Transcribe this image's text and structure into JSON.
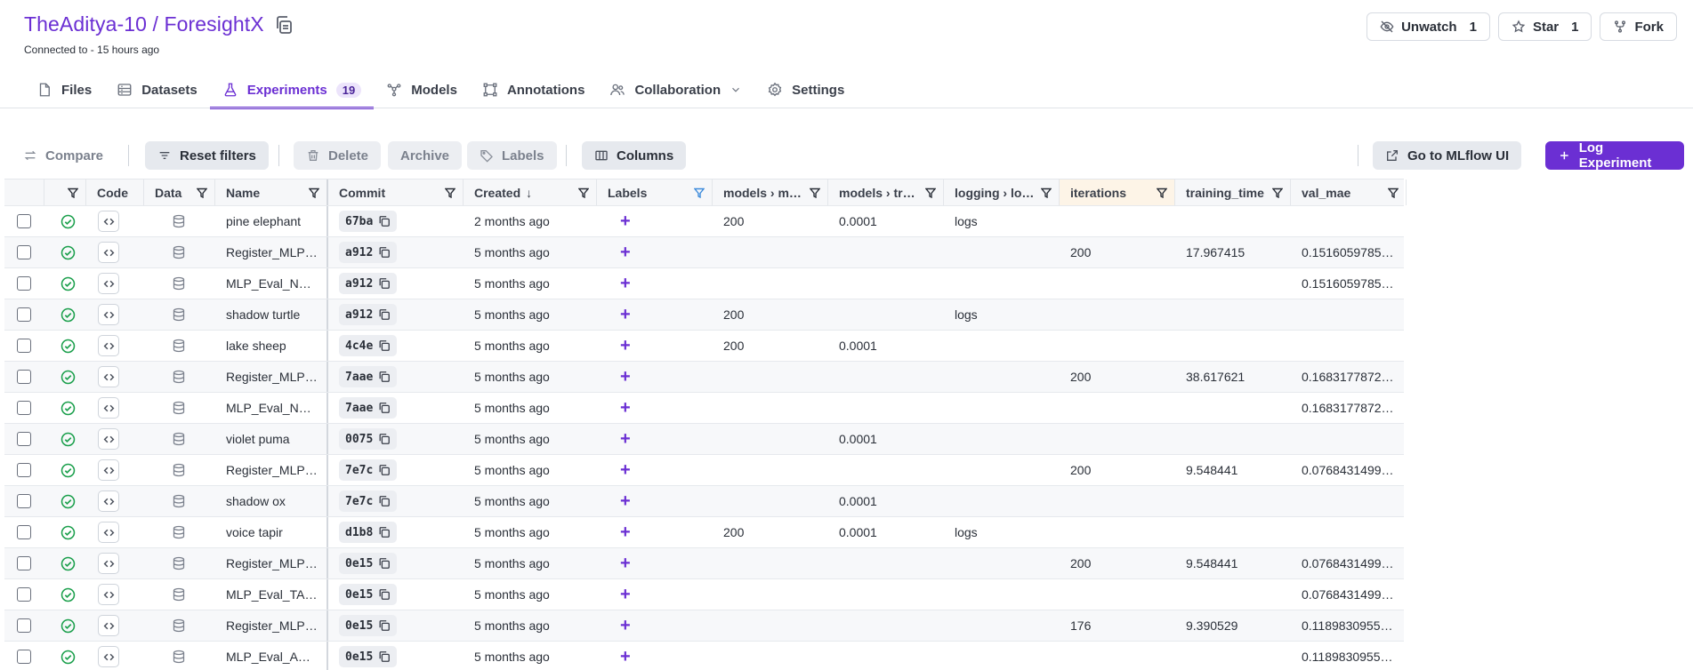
{
  "repo": {
    "title": "TheAditya-10 / ForesightX",
    "connected": "Connected to  - 15 hours ago"
  },
  "top_actions": {
    "unwatch_label": "Unwatch",
    "unwatch_count": "1",
    "star_label": "Star",
    "star_count": "1",
    "fork_label": "Fork"
  },
  "tabs": [
    {
      "label": "Files",
      "icon": "file-icon"
    },
    {
      "label": "Datasets",
      "icon": "datasets-icon"
    },
    {
      "label": "Experiments",
      "icon": "flask-icon",
      "count": "19",
      "active": true
    },
    {
      "label": "Models",
      "icon": "models-icon"
    },
    {
      "label": "Annotations",
      "icon": "annotations-icon"
    },
    {
      "label": "Collaboration",
      "icon": "people-icon",
      "dropdown": true
    },
    {
      "label": "Settings",
      "icon": "gear-icon"
    }
  ],
  "toolbar": {
    "compare": "Compare",
    "reset_filters": "Reset filters",
    "delete": "Delete",
    "archive": "Archive",
    "labels": "Labels",
    "columns": "Columns",
    "mlflow": "Go to MLflow UI",
    "log_experiment": "Log Experiment"
  },
  "columns": {
    "code": "Code",
    "data": "Data",
    "name": "Name",
    "commit": "Commit",
    "created": "Created",
    "labels": "Labels",
    "models_m": "models › m…",
    "models_tr": "models › tr…",
    "logging": "logging › lo…",
    "iterations": "iterations",
    "training_time": "training_time",
    "val_mae": "val_mae"
  },
  "rows": [
    {
      "name": "pine elephant",
      "commit": "67ba",
      "created": "2 months ago",
      "mm": "200",
      "mt": "0.0001",
      "log": "logs",
      "it": "",
      "tt": "",
      "vm": ""
    },
    {
      "name": "Register_MLP…",
      "commit": "a912",
      "created": "5 months ago",
      "mm": "",
      "mt": "",
      "log": "",
      "it": "200",
      "tt": "17.967415",
      "vm": "0.1516059785…"
    },
    {
      "name": "MLP_Eval_N…",
      "commit": "a912",
      "created": "5 months ago",
      "mm": "",
      "mt": "",
      "log": "",
      "it": "",
      "tt": "",
      "vm": "0.1516059785…"
    },
    {
      "name": "shadow turtle",
      "commit": "a912",
      "created": "5 months ago",
      "mm": "200",
      "mt": "",
      "log": "logs",
      "it": "",
      "tt": "",
      "vm": ""
    },
    {
      "name": "lake sheep",
      "commit": "4c4e",
      "created": "5 months ago",
      "mm": "200",
      "mt": "0.0001",
      "log": "",
      "it": "",
      "tt": "",
      "vm": ""
    },
    {
      "name": "Register_MLP…",
      "commit": "7aae",
      "created": "5 months ago",
      "mm": "",
      "mt": "",
      "log": "",
      "it": "200",
      "tt": "38.617621",
      "vm": "0.1683177872…"
    },
    {
      "name": "MLP_Eval_N…",
      "commit": "7aae",
      "created": "5 months ago",
      "mm": "",
      "mt": "",
      "log": "",
      "it": "",
      "tt": "",
      "vm": "0.1683177872…"
    },
    {
      "name": "violet puma",
      "commit": "0075",
      "created": "5 months ago",
      "mm": "",
      "mt": "0.0001",
      "log": "",
      "it": "",
      "tt": "",
      "vm": ""
    },
    {
      "name": "Register_MLP…",
      "commit": "7e7c",
      "created": "5 months ago",
      "mm": "",
      "mt": "",
      "log": "",
      "it": "200",
      "tt": "9.548441",
      "vm": "0.0768431499…"
    },
    {
      "name": "shadow ox",
      "commit": "7e7c",
      "created": "5 months ago",
      "mm": "",
      "mt": "0.0001",
      "log": "",
      "it": "",
      "tt": "",
      "vm": ""
    },
    {
      "name": "voice tapir",
      "commit": "d1b8",
      "created": "5 months ago",
      "mm": "200",
      "mt": "0.0001",
      "log": "logs",
      "it": "",
      "tt": "",
      "vm": ""
    },
    {
      "name": "Register_MLP…",
      "commit": "0e15",
      "created": "5 months ago",
      "mm": "",
      "mt": "",
      "log": "",
      "it": "200",
      "tt": "9.548441",
      "vm": "0.0768431499…"
    },
    {
      "name": "MLP_Eval_TA…",
      "commit": "0e15",
      "created": "5 months ago",
      "mm": "",
      "mt": "",
      "log": "",
      "it": "",
      "tt": "",
      "vm": "0.0768431499…"
    },
    {
      "name": "Register_MLP…",
      "commit": "0e15",
      "created": "5 months ago",
      "mm": "",
      "mt": "",
      "log": "",
      "it": "176",
      "tt": "9.390529",
      "vm": "0.1189830955…"
    },
    {
      "name": "MLP_Eval_A…",
      "commit": "0e15",
      "created": "5 months ago",
      "mm": "",
      "mt": "",
      "log": "",
      "it": "",
      "tt": "",
      "vm": "0.1189830955…"
    }
  ]
}
